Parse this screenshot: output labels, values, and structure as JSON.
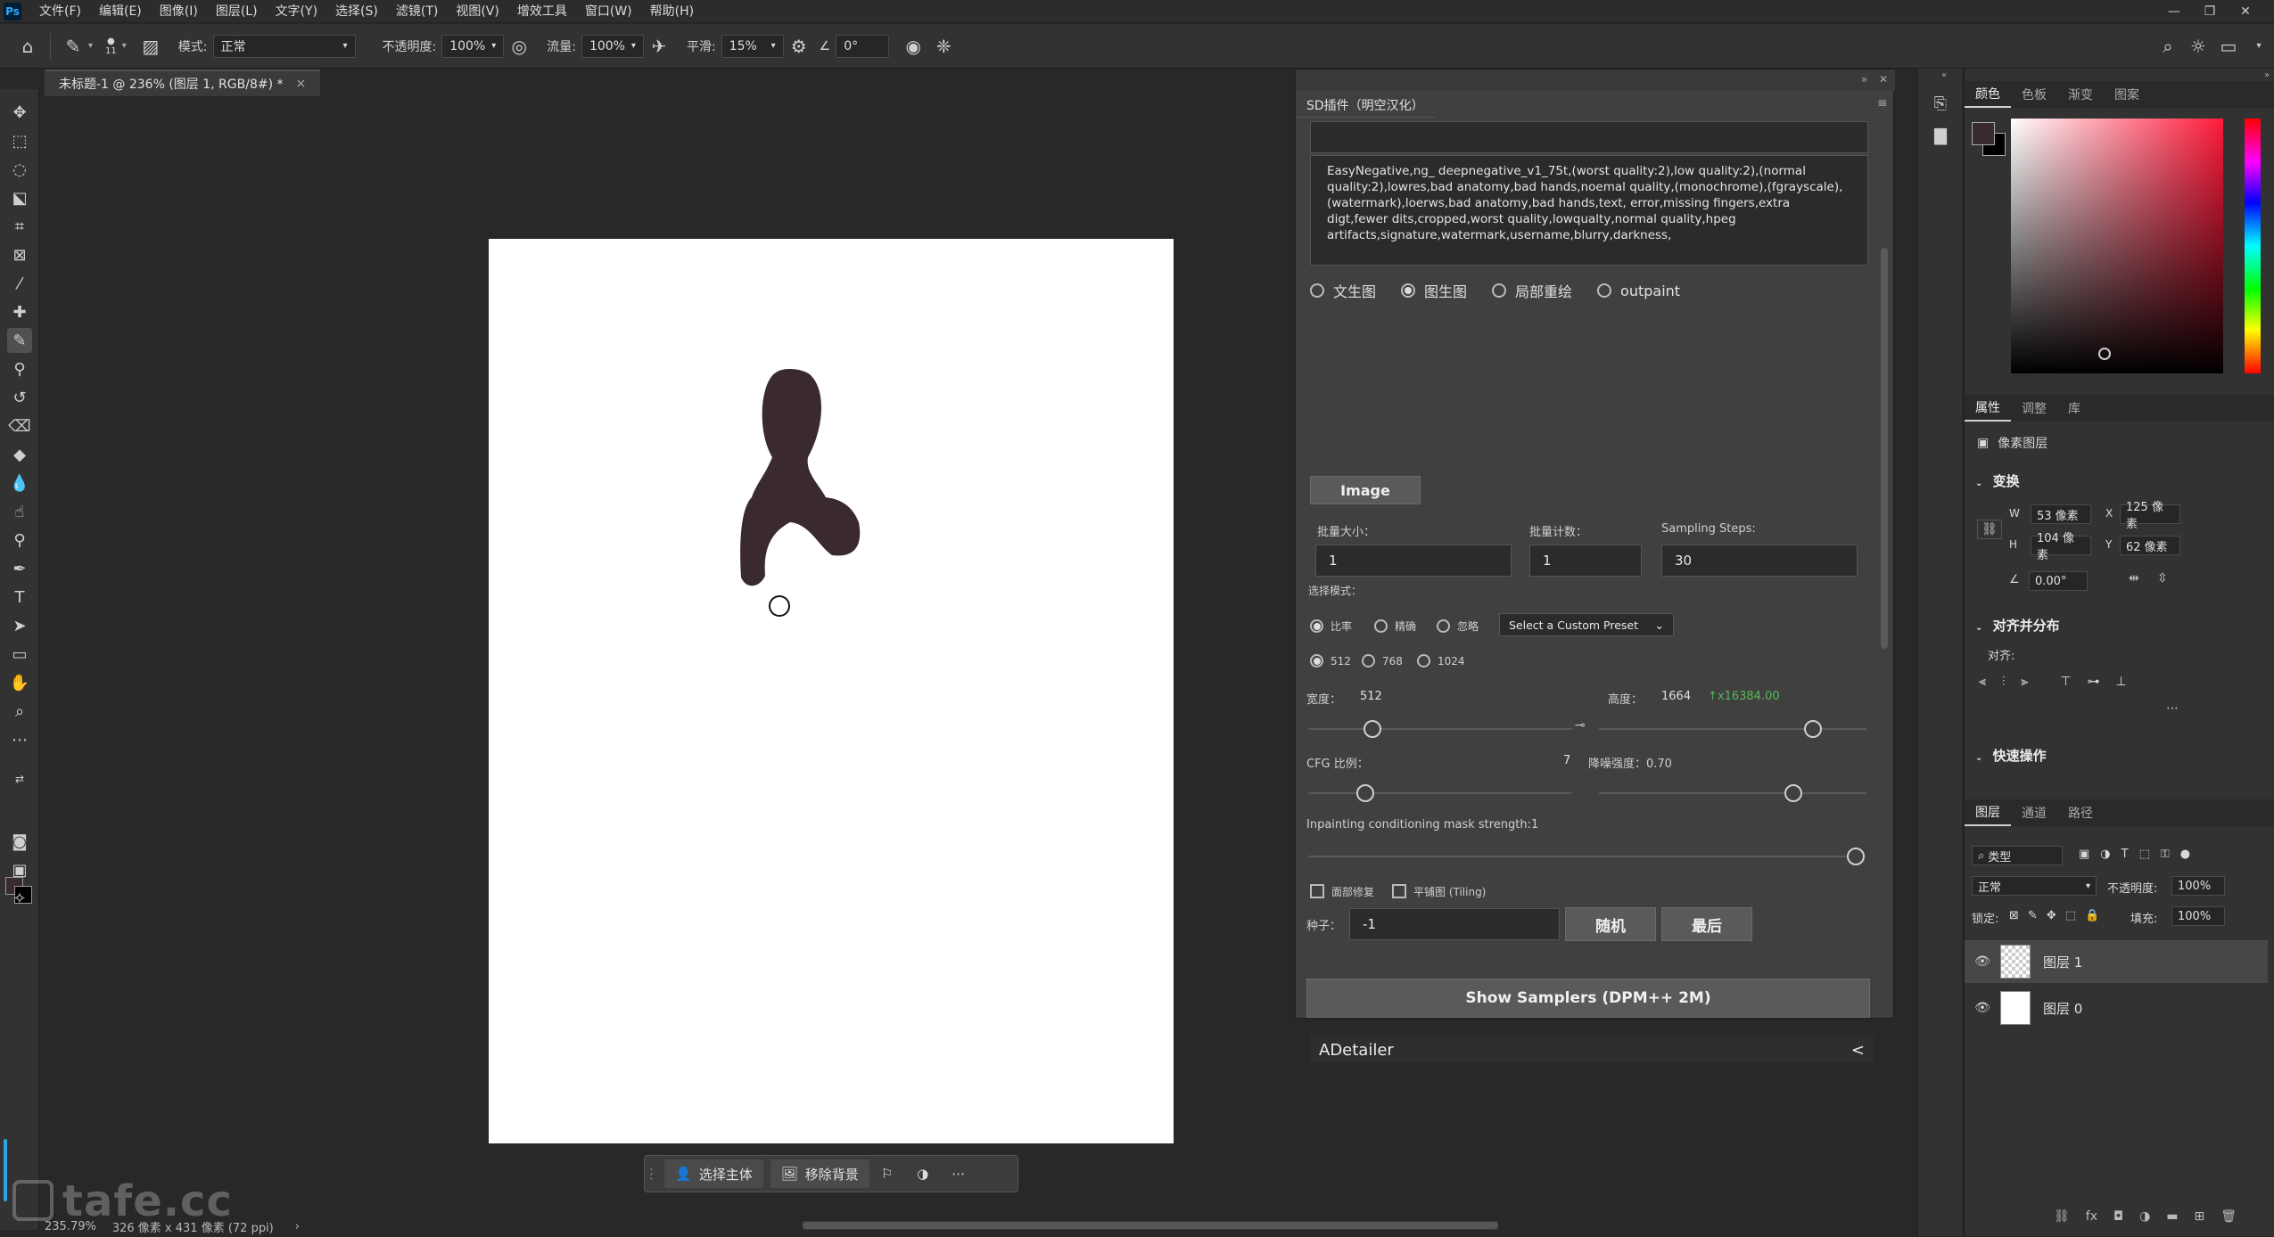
{
  "menubar": {
    "logo": "Ps",
    "items": [
      "文件(F)",
      "编辑(E)",
      "图像(I)",
      "图层(L)",
      "文字(Y)",
      "选择(S)",
      "滤镜(T)",
      "视图(V)",
      "增效工具",
      "窗口(W)",
      "帮助(H)"
    ]
  },
  "options": {
    "brush_size": "11",
    "mode_label": "模式:",
    "mode_value": "正常",
    "opacity_label": "不透明度:",
    "opacity_value": "100%",
    "flow_label": "流量:",
    "flow_value": "100%",
    "smooth_label": "平滑:",
    "smooth_value": "15%",
    "angle_value": "0°"
  },
  "document": {
    "tab_title": "未标题-1 @ 236% (图层 1, RGB/8#) *",
    "close": "×"
  },
  "taskbar": {
    "select_subject": "选择主体",
    "remove_bg": "移除背景"
  },
  "status": {
    "zoom": "235.79%",
    "info": "326 像素 x 431 像素 (72 ppi)",
    "arrow": "›"
  },
  "watermark": "tafe.cc",
  "sd": {
    "tab_title": "SD插件（明空汉化）",
    "negative_prompt": "EasyNegative,ng_ deepnegative_v1_75t,(worst quality:2),low quality:2),(normal quality:2),lowres,bad anatomy,bad hands,noemal quality,(monochrome),(fgrayscale),(watermark),loerws,bad anatomy,bad hands,text, error,missing fingers,extra digt,fewer dits,cropped,worst quality,lowqualty,normal quality,hpeg artifacts,signature,watermark,username,blurry,darkness,",
    "modes": [
      {
        "label": "文生图",
        "selected": false
      },
      {
        "label": "图生图",
        "selected": true
      },
      {
        "label": "局部重绘",
        "selected": false
      },
      {
        "label": "outpaint",
        "selected": false
      }
    ],
    "image_button": "Image",
    "batch_size_label": "批量大小：",
    "batch_size": "1",
    "batch_count_label": "批量计数：",
    "batch_count": "1",
    "steps_label": "Sampling Steps:",
    "steps": "30",
    "select_mode_label": "选择模式：",
    "scale_modes": [
      {
        "label": "比率",
        "selected": true
      },
      {
        "label": "精确",
        "selected": false
      },
      {
        "label": "忽略",
        "selected": false
      }
    ],
    "preset": "Select a Custom Preset",
    "sizes": [
      {
        "label": "512",
        "selected": true
      },
      {
        "label": "768",
        "selected": false
      },
      {
        "label": "1024",
        "selected": false
      }
    ],
    "width_label": "宽度：",
    "width": "512",
    "height_label": "高度：",
    "height": "1664",
    "ratio": "↑x16384.00",
    "cfg_label": "CFG 比例：",
    "cfg": "7",
    "denoise_label": "降噪强度：0.70",
    "mask_strength_label": "Inpainting conditioning mask strength:1",
    "face_fix": "面部修复",
    "tiling": "平铺图 (Tiling)",
    "seed_label": "种子：",
    "seed": "-1",
    "random_button": "随机",
    "last_button": "最后",
    "samplers_button": "Show Samplers (DPM++ 2M)",
    "adetailer": "ADetailer",
    "adetailer_arrow": "<"
  },
  "panels": {
    "color_tabs": [
      "颜色",
      "色板",
      "渐变",
      "图案"
    ],
    "props_tabs": [
      "属性",
      "调整",
      "库"
    ],
    "pixel_layer": "像素图层",
    "transform": "变换",
    "w_label": "W",
    "w_value": "53 像素",
    "x_label": "X",
    "x_value": "125 像素",
    "h_label": "H",
    "h_value": "104 像素",
    "y_label": "Y",
    "y_value": "62 像素",
    "angle": "0.00°",
    "align_title": "对齐并分布",
    "align_label": "对齐:",
    "quick_actions": "快速操作",
    "layer_tabs": [
      "图层",
      "通道",
      "路径"
    ],
    "filter_kind": "类型",
    "blend_mode": "正常",
    "opacity_label": "不透明度:",
    "opacity_value": "100%",
    "lock_label": "锁定:",
    "fill_label": "填充:",
    "fill_value": "100%",
    "layers": [
      {
        "name": "图层 1",
        "active": true
      },
      {
        "name": "图层 0",
        "active": false
      }
    ]
  },
  "colors": {
    "foreground": "#3a2a2e",
    "background": "#000000",
    "accent": "#2ba5e6",
    "ratio_green": "#59b85a"
  }
}
